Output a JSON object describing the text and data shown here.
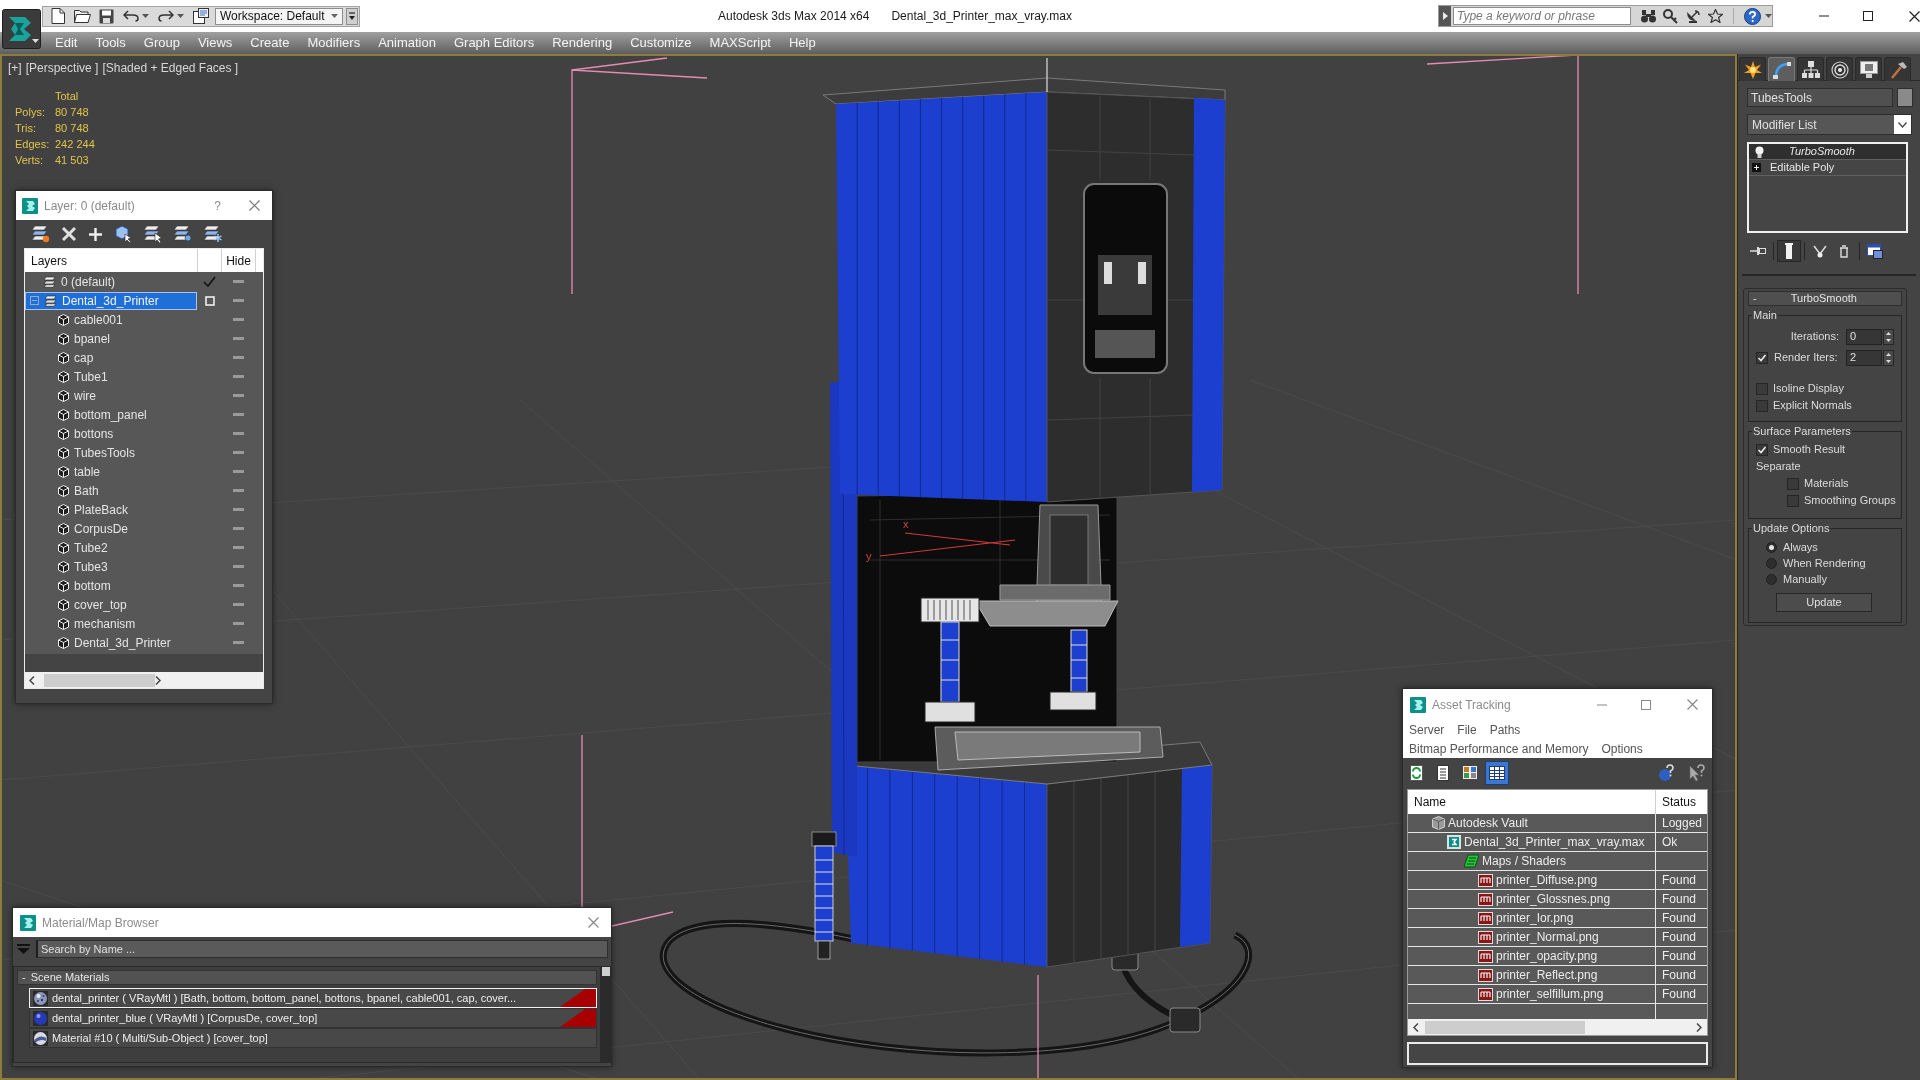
{
  "title_bar": {
    "workspace": "Workspace: Default",
    "app_title": "Autodesk 3ds Max 2014 x64",
    "file_name": "Dental_3d_Printer_max_vray.max",
    "search": {
      "placeholder": "Type a keyword or phrase"
    }
  },
  "menu": [
    "Edit",
    "Tools",
    "Group",
    "Views",
    "Create",
    "Modifiers",
    "Animation",
    "Graph Editors",
    "Rendering",
    "Customize",
    "MAXScript",
    "Help"
  ],
  "viewport": {
    "labels": [
      "[+]",
      "[Perspective ]",
      "[Shaded + Edged Faces ]"
    ],
    "stats": {
      "heading": "Total",
      "rows": [
        {
          "label": "Polys:",
          "value": "80 748"
        },
        {
          "label": "Tris:",
          "value": "80 748"
        },
        {
          "label": "Edges:",
          "value": "242 244"
        },
        {
          "label": "Verts:",
          "value": "41 503"
        }
      ]
    },
    "axis_labels": [
      "x",
      "y"
    ]
  },
  "layer_panel": {
    "title": "Layer: 0 (default)",
    "help": "?",
    "columns": [
      "Layers",
      "Hide"
    ],
    "layers": [
      {
        "name": "0 (default)",
        "selected": false,
        "current": true,
        "hidden": false
      },
      {
        "name": "Dental_3d_Printer",
        "selected": true,
        "current": false,
        "hidden": false,
        "expanded": true,
        "children": [
          {
            "name": "cable001",
            "selected": false,
            "hidden": false
          },
          {
            "name": "bpanel",
            "selected": false,
            "hidden": false
          },
          {
            "name": "cap",
            "selected": false,
            "hidden": false
          },
          {
            "name": "Tube1",
            "selected": false,
            "hidden": false
          },
          {
            "name": "wire",
            "selected": false,
            "hidden": false
          },
          {
            "name": "bottom_panel",
            "selected": false,
            "hidden": false
          },
          {
            "name": "bottons",
            "selected": false,
            "hidden": false
          },
          {
            "name": "TubesTools",
            "selected": false,
            "hidden": false
          },
          {
            "name": "table",
            "selected": false,
            "hidden": false
          },
          {
            "name": "Bath",
            "selected": false,
            "hidden": false
          },
          {
            "name": "PlateBack",
            "selected": false,
            "hidden": false
          },
          {
            "name": "CorpusDe",
            "selected": false,
            "hidden": false
          },
          {
            "name": "Tube2",
            "selected": false,
            "hidden": false
          },
          {
            "name": "Tube3",
            "selected": false,
            "hidden": false
          },
          {
            "name": "bottom",
            "selected": false,
            "hidden": false
          },
          {
            "name": "cover_top",
            "selected": false,
            "hidden": false
          },
          {
            "name": "mechanism",
            "selected": false,
            "hidden": false
          },
          {
            "name": "Dental_3d_Printer",
            "selected": false,
            "hidden": false
          }
        ]
      }
    ]
  },
  "command_panel": {
    "tabs": [
      {
        "kind": "create",
        "selected": false
      },
      {
        "kind": "modify",
        "selected": true
      },
      {
        "kind": "hierarchy",
        "selected": false
      },
      {
        "kind": "motion",
        "selected": false
      },
      {
        "kind": "display",
        "selected": false
      },
      {
        "kind": "utilities",
        "selected": false
      }
    ],
    "object_name": "TubesTools",
    "modifier_list": "Modifier List",
    "stack": [
      {
        "kind": "modifier",
        "name": "TurboSmooth",
        "selected": true,
        "italic": true
      },
      {
        "kind": "object",
        "name": "Editable Poly",
        "selected": false,
        "italic": false
      }
    ],
    "stack_tools": [
      {
        "kind": "pin",
        "on": false
      },
      {
        "kind": "end_result",
        "on": true
      },
      {
        "kind": "unique",
        "on": false
      },
      {
        "kind": "remove",
        "on": false
      },
      {
        "kind": "configure",
        "on": false
      }
    ],
    "rollout": {
      "toggle": "-",
      "title": "TurboSmooth",
      "groups": [
        {
          "title": "Main",
          "items": [
            {
              "kind": "spinner",
              "label": "Iterations:",
              "value": "0"
            },
            {
              "kind": "check_spinner",
              "label": "Render Iters:",
              "value": "2",
              "checked": true
            },
            {
              "kind": "checkbox",
              "label": "Isoline Display",
              "checked": false
            },
            {
              "kind": "checkbox",
              "label": "Explicit Normals",
              "checked": false
            }
          ]
        },
        {
          "title": "Surface Parameters",
          "items": [
            {
              "kind": "checkbox",
              "label": "Smooth Result",
              "checked": true
            },
            {
              "kind": "heading",
              "label": "Separate",
              "children": [
                {
                  "kind": "checkbox",
                  "label": "Materials",
                  "checked": false
                },
                {
                  "kind": "checkbox",
                  "label": "Smoothing Groups",
                  "checked": false
                }
              ]
            }
          ]
        },
        {
          "title": "Update Options",
          "items": [
            {
              "kind": "radio",
              "label": "Always",
              "selected": true
            },
            {
              "kind": "radio",
              "label": "When Rendering",
              "selected": false
            },
            {
              "kind": "radio",
              "label": "Manually",
              "selected": false
            },
            {
              "kind": "button",
              "label": "Update"
            }
          ]
        }
      ]
    }
  },
  "asset_tracking": {
    "title": "Asset Tracking",
    "menu_rows": [
      [
        "Server",
        "File",
        "Paths"
      ],
      [
        "Bitmap Performance and Memory",
        "Options"
      ]
    ],
    "toolbar": [
      {
        "kind": "refresh",
        "selected": false
      },
      {
        "kind": "list",
        "selected": false
      },
      {
        "kind": "thumbnails",
        "selected": false
      },
      {
        "kind": "table",
        "selected": true
      }
    ],
    "columns": [
      "Name",
      "Status"
    ],
    "tree": [
      {
        "kind": "vault",
        "name": "Autodesk Vault",
        "status": "Logged",
        "children": [
          {
            "kind": "scene",
            "name": "Dental_3d_Printer_max_vray.max",
            "status": "Ok",
            "children": [
              {
                "kind": "folder",
                "name": "Maps / Shaders",
                "children": [
                  {
                    "kind": "png",
                    "name": "printer_Diffuse.png",
                    "status": "Found"
                  },
                  {
                    "kind": "png",
                    "name": "printer_Glossnes.png",
                    "status": "Found"
                  },
                  {
                    "kind": "png",
                    "name": "printer_Ior.png",
                    "status": "Found"
                  },
                  {
                    "kind": "png",
                    "name": "printer_Normal.png",
                    "status": "Found"
                  },
                  {
                    "kind": "png",
                    "name": "printer_opacity.png",
                    "status": "Found"
                  },
                  {
                    "kind": "png",
                    "name": "printer_Reflect.png",
                    "status": "Found"
                  },
                  {
                    "kind": "png",
                    "name": "printer_selfillum.png",
                    "status": "Found"
                  }
                ]
              }
            ]
          }
        ]
      }
    ]
  },
  "material_browser": {
    "title": "Material/Map Browser",
    "search": {
      "placeholder": "Search by Name ..."
    },
    "section": {
      "toggle": "-",
      "title": "Scene Materials"
    },
    "materials": [
      {
        "kind": "speckled",
        "text": "dental_printer ( VRayMtl ) [Bath, bottom, bottom_panel, bottons, bpanel, cable001, cap, cover...",
        "selected": true,
        "flagged": true
      },
      {
        "kind": "solid",
        "text": "dental_printer_blue ( VRayMtl ) [CorpusDe, cover_top]",
        "selected": false,
        "flagged": true
      },
      {
        "kind": "multi",
        "text": "Material #10 ( Multi/Sub-Object ) [cover_top]",
        "selected": false,
        "flagged": false
      }
    ]
  }
}
